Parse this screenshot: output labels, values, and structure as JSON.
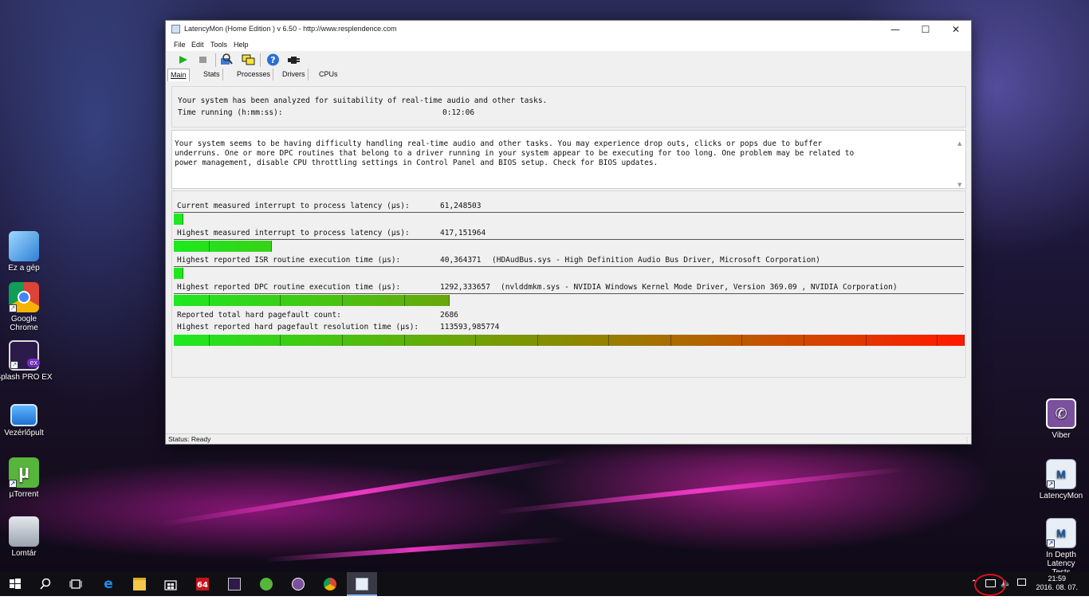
{
  "desktop": {
    "left_icons": [
      {
        "label": "Ez a gép",
        "icon": "computer-icon"
      },
      {
        "label": "Google Chrome",
        "icon": "chrome-icon"
      },
      {
        "label": "Splash PRO EX",
        "icon": "splash-icon"
      },
      {
        "label": "Vezérlőpult",
        "icon": "control-panel-icon"
      },
      {
        "label": "µTorrent",
        "icon": "utorrent-icon"
      },
      {
        "label": "Lomtár",
        "icon": "recycle-bin-icon"
      }
    ],
    "right_icons": [
      {
        "label": "Viber",
        "icon": "viber-icon"
      },
      {
        "label": "LatencyMon",
        "icon": "latencymon-icon"
      },
      {
        "label": "In Depth Latency Tests",
        "icon": "latencymon-icon"
      }
    ]
  },
  "window": {
    "title": "LatencyMon  (Home Edition )  v 6.50 - http://www.resplendence.com",
    "menu": [
      "File",
      "Edit",
      "Tools",
      "Help"
    ],
    "tabs": [
      "Main",
      "Stats",
      "Processes",
      "Drivers",
      "CPUs"
    ],
    "active_tab": "Main",
    "summary": {
      "line1": "Your system has been analyzed for suitability of real-time audio and other tasks.",
      "time_label": "Time running (h:mm:ss):",
      "time_value": "0:12:06"
    },
    "message": [
      "Your system seems to be having difficulty handling real-time audio and other tasks. You may experience drop outs, clicks or pops due to buffer",
      "underruns. One or more DPC routines that belong to a driver running in your system appear to be executing for too long. One problem may be related to",
      "power management, disable CPU throttling settings in Control Panel and BIOS setup. Check for BIOS updates."
    ],
    "metrics": [
      {
        "label": "Current measured interrupt to process latency (µs):",
        "value": "61,248503",
        "detail": "",
        "level": 0.012
      },
      {
        "label": "Highest measured interrupt to process latency (µs):",
        "value": "417,151964",
        "detail": "",
        "level": 0.125
      },
      {
        "label": "Highest reported ISR routine execution time (µs):",
        "value": "40,364371",
        "detail": "(HDAudBus.sys - High Definition Audio Bus Driver, Microsoft Corporation)",
        "level": 0.012
      },
      {
        "label": "Highest reported DPC routine execution time (µs):",
        "value": "1292,333657",
        "detail": "(nvlddmkm.sys - NVIDIA Windows Kernel Mode Driver, Version 369.09 , NVIDIA Corporation)",
        "level": 0.348
      },
      {
        "label": "Reported total hard pagefault count:",
        "value": "2686",
        "detail": "",
        "level": null
      },
      {
        "label": "Highest reported hard pagefault resolution time (µs):",
        "value": "113593,985774",
        "detail": "",
        "level": 1.0
      }
    ],
    "status": "Status: Ready"
  },
  "taskbar": {
    "time": "21:59",
    "date": "2016. 08. 07."
  },
  "colors": {
    "meter_start": "#1ee81e",
    "meter_mid": "#8a8a00",
    "meter_end": "#ff1a00",
    "annotation_circle": "#e0101a"
  }
}
